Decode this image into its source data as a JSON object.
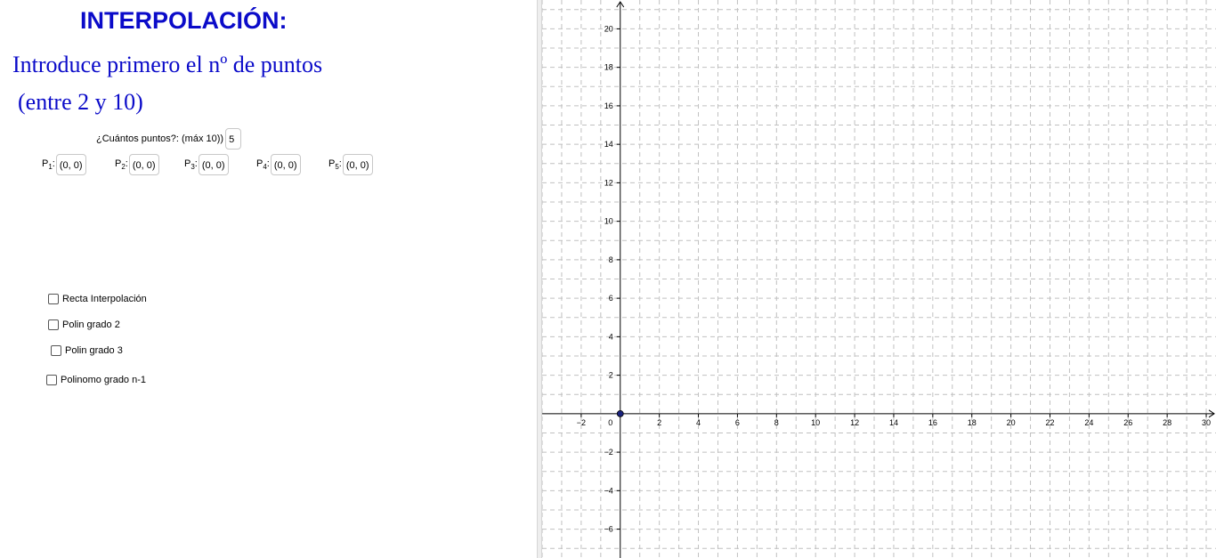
{
  "header": {
    "title": "INTERPOLACIÓN:",
    "subtitle_line1": "Introduce primero el nº de puntos",
    "subtitle_line2": "(entre 2 y 10)"
  },
  "count": {
    "label": "¿Cuántos puntos?: (máx 10))",
    "value": "5"
  },
  "points": [
    {
      "name": "P",
      "index": "1",
      "value": "(0, 0)"
    },
    {
      "name": "P",
      "index": "2",
      "value": "(0, 0)"
    },
    {
      "name": "P",
      "index": "3",
      "value": "(0, 0)"
    },
    {
      "name": "P",
      "index": "4",
      "value": "(0, 0)"
    },
    {
      "name": "P",
      "index": "5",
      "value": "(0, 0)"
    }
  ],
  "checkboxes": [
    {
      "label": "Recta Interpolación",
      "checked": false
    },
    {
      "label": "Polin grado 2",
      "checked": false
    },
    {
      "label": "Polin grado 3",
      "checked": false
    },
    {
      "label": "Polinomo grado n-1",
      "checked": false
    }
  ],
  "chart_data": {
    "type": "scatter",
    "xlim": [
      -4,
      30.5
    ],
    "ylim": [
      -7.5,
      21.5
    ],
    "x_ticks": [
      -2,
      0,
      2,
      4,
      6,
      8,
      10,
      12,
      14,
      16,
      18,
      20,
      22,
      24,
      26,
      28,
      30
    ],
    "y_ticks": [
      -6,
      -4,
      -2,
      2,
      4,
      6,
      8,
      10,
      12,
      14,
      16,
      18,
      20
    ],
    "grid": true,
    "grid_style": "dashed",
    "points": [
      {
        "x": 0,
        "y": 0
      }
    ],
    "colors": {
      "point": "#1a237e",
      "grid": "#c0c0c0",
      "axis": "#000000"
    }
  }
}
